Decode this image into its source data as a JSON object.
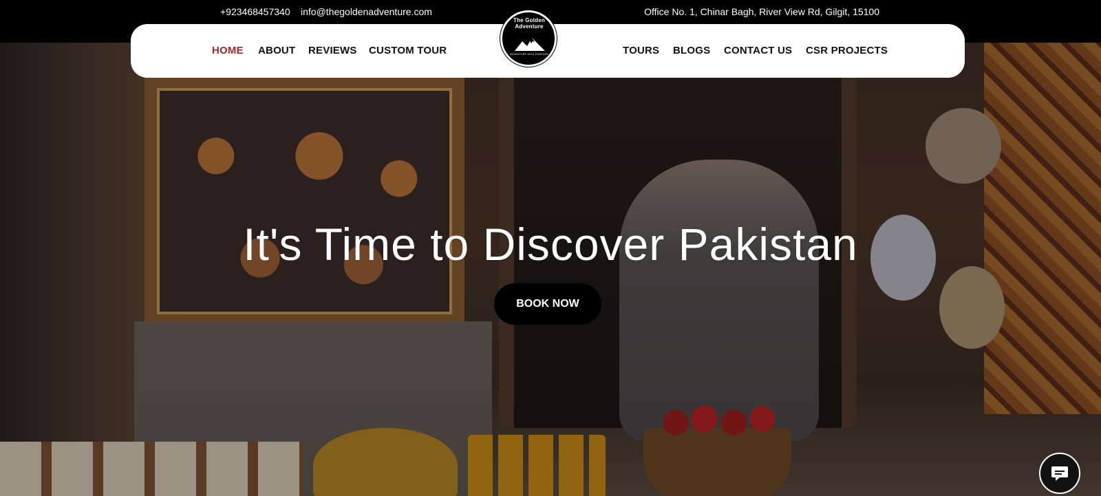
{
  "topbar": {
    "phone": "+923468457340",
    "email": "info@thegoldenadventure.com",
    "address": "Office No. 1, Chinar Bagh, River View Rd, Gilgit, 15100"
  },
  "nav": {
    "left_items": [
      {
        "label": "HOME",
        "active": true
      },
      {
        "label": "ABOUT",
        "active": false
      },
      {
        "label": "REVIEWS",
        "active": false
      },
      {
        "label": "CUSTOM TOUR",
        "active": false
      }
    ],
    "right_items": [
      {
        "label": "TOURS",
        "active": false
      },
      {
        "label": "BLOGS",
        "active": false
      },
      {
        "label": "CONTACT US",
        "active": false
      },
      {
        "label": "CSR PROJECTS",
        "active": false
      }
    ],
    "active_color": "#9b2a2c"
  },
  "logo": {
    "text": "The Golden Adventure",
    "tagline": "ADVENTURE WITH PURPOSE",
    "icon": "mountain-icon"
  },
  "hero": {
    "title": "It's Time to Discover Pakistan",
    "cta_label": "BOOK NOW"
  },
  "chat": {
    "icon": "chat-icon"
  }
}
